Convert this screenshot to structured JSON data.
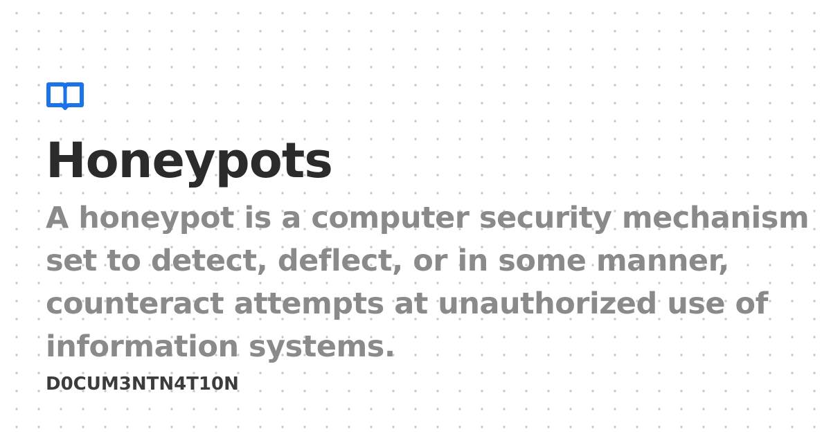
{
  "logo": {
    "icon": "open-book-icon",
    "color": "#1a73e8"
  },
  "title": "Honeypots",
  "description": "A honeypot is a computer security mechanism set to detect, deflect, or in some manner, counteract attempts at unauthorized use of information systems.",
  "site_name": "D0CUM3NTN4T10N",
  "colors": {
    "title": "#2b2b2b",
    "description": "#8a8a8a",
    "site_name": "#3c3c3c",
    "background_dots": "#c9c9c9"
  }
}
